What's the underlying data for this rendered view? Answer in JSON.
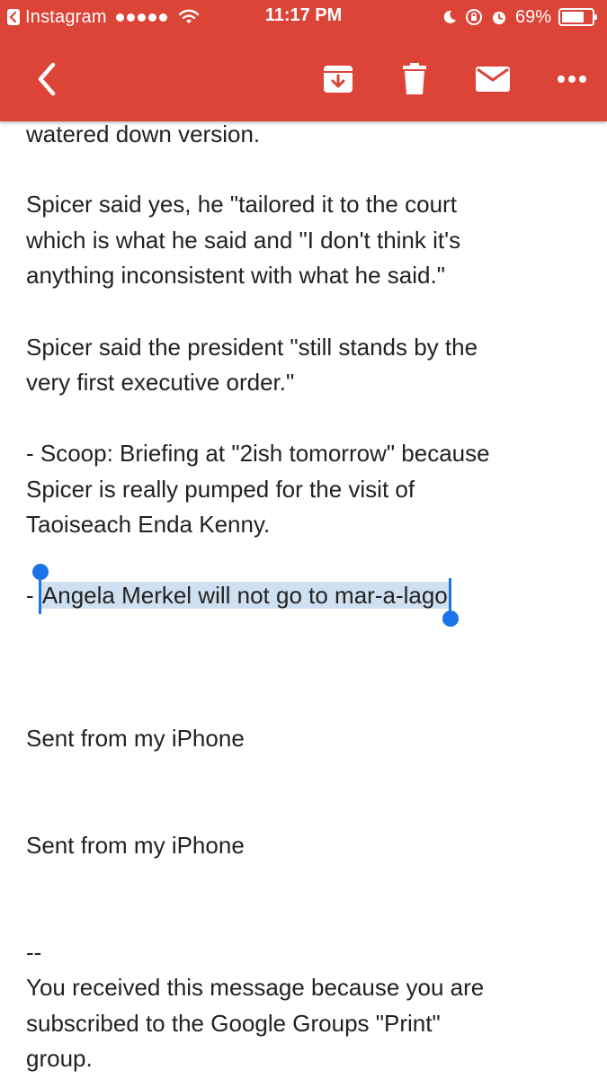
{
  "status_bar": {
    "back_app": "Instagram",
    "time": "11:17 PM",
    "battery": "69%",
    "icons": [
      "back-triangle-icon",
      "signal-dots-icon",
      "wifi-icon",
      "moon-icon",
      "orientation-lock-icon",
      "alarm-icon",
      "battery-icon"
    ]
  },
  "toolbar": {
    "color": "#db4437",
    "icons": [
      "back-arrow-icon",
      "archive-icon",
      "trash-icon",
      "mail-icon",
      "more-icon"
    ]
  },
  "message": {
    "lines": [
      "watered down version.",
      "Spicer said yes, he \"tailored it to the court",
      "which is what he said and \"I don't think it's",
      "anything inconsistent with what he said.\"",
      "Spicer said the president \"still stands by the",
      "very first executive order.\"",
      "- Scoop: Briefing at \"2ish tomorrow\" because",
      "Spicer is really pumped for the visit of",
      "Taoiseach Enda Kenny.",
      "- ",
      "Angela Merkel will not go to mar-a-lago",
      "Sent from my iPhone",
      "Sent from my iPhone",
      "--",
      "You received this message because you are",
      "subscribed to the Google Groups \"Print\"",
      "group."
    ],
    "selection_color": "#cfe0f1",
    "handle_color": "#1a73e8"
  }
}
